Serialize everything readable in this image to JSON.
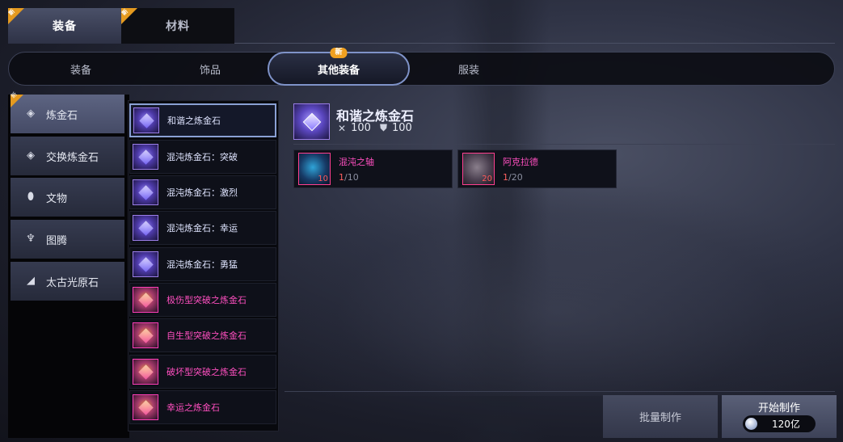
{
  "top_tabs": [
    {
      "label": "装备",
      "new": "新",
      "active": true
    },
    {
      "label": "材料",
      "new": "新",
      "active": false
    }
  ],
  "sub_tabs": [
    {
      "label": "装备",
      "active": false
    },
    {
      "label": "饰品",
      "active": false
    },
    {
      "label": "其他装备",
      "active": true,
      "badge": "新"
    },
    {
      "label": "服装",
      "active": false
    }
  ],
  "categories": [
    {
      "label": "炼金石",
      "icon": "alchemy-stone-icon",
      "active": true,
      "new": "新"
    },
    {
      "label": "交换炼金石",
      "icon": "exchange-stone-icon",
      "active": false
    },
    {
      "label": "文物",
      "icon": "relic-icon",
      "active": false
    },
    {
      "label": "图腾",
      "icon": "totem-icon",
      "active": false
    },
    {
      "label": "太古光原石",
      "icon": "primordial-ore-icon",
      "active": false
    }
  ],
  "items": [
    {
      "name": "和谐之炼金石",
      "rarity": "purple",
      "selected": true
    },
    {
      "name": "混沌炼金石：突破",
      "rarity": "purple",
      "selected": false
    },
    {
      "name": "混沌炼金石：激烈",
      "rarity": "purple",
      "selected": false
    },
    {
      "name": "混沌炼金石：幸运",
      "rarity": "purple",
      "selected": false
    },
    {
      "name": "混沌炼金石：勇猛",
      "rarity": "purple",
      "selected": false
    },
    {
      "name": "极伤型突破之炼金石",
      "rarity": "pink",
      "selected": false
    },
    {
      "name": "自生型突破之炼金石",
      "rarity": "pink",
      "selected": false
    },
    {
      "name": "破坏型突破之炼金石",
      "rarity": "pink",
      "selected": false
    },
    {
      "name": "幸运之炼金石",
      "rarity": "pink",
      "selected": false
    }
  ],
  "detail": {
    "title": "和谐之炼金石",
    "attack": "100",
    "defense": "100"
  },
  "materials": [
    {
      "name": "混沌之轴",
      "level": "10",
      "have": "1",
      "need": "/10",
      "color": "blue"
    },
    {
      "name": "阿克拉德",
      "level": "20",
      "have": "1",
      "need": "/20",
      "color": "grey"
    }
  ],
  "buttons": {
    "batch": "批量制作",
    "start": "开始制作",
    "cost": "120亿"
  },
  "colors": {
    "accent_badge": "#e59a1f",
    "rare_pink": "#ff4fc0",
    "insufficient_red": "#ff6060"
  }
}
